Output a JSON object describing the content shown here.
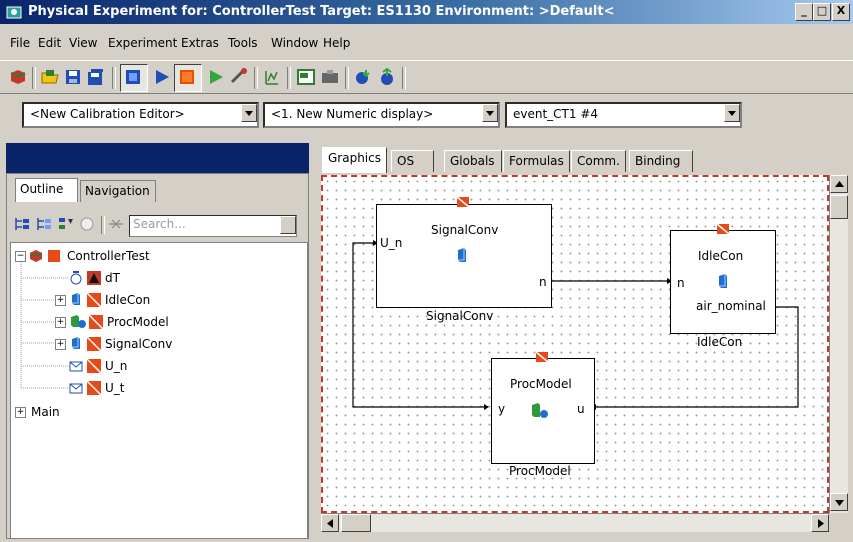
{
  "window": {
    "title": "Physical Experiment for: ControllerTest  Target: ES1130  Environment: >Default<",
    "controls": {
      "minimize": "_",
      "maximize": "□",
      "close": "X"
    }
  },
  "menu": [
    "File",
    "Edit",
    "View",
    "Experiment",
    "Extras",
    "Tools",
    "Window",
    "Help"
  ],
  "dropdowns": {
    "calibration": "<New Calibration Editor>",
    "display": "<1. New Numeric display>",
    "event": "event_CT1   #4"
  },
  "left_panel": {
    "tabs": [
      "Outline",
      "Navigation"
    ],
    "active_tab": "Outline",
    "search_placeholder": "Search...",
    "tree": [
      {
        "label": "ControllerTest",
        "expander": "−"
      },
      {
        "label": "dT",
        "expander": ""
      },
      {
        "label": "IdleCon",
        "expander": "+"
      },
      {
        "label": "ProcModel",
        "expander": "+"
      },
      {
        "label": "SignalConv",
        "expander": "+"
      },
      {
        "label": "U_n",
        "expander": ""
      },
      {
        "label": "U_t",
        "expander": ""
      },
      {
        "label": "Main",
        "expander": "+"
      }
    ]
  },
  "editor": {
    "tabs": [
      "Graphics",
      "OS",
      "Globals",
      "Formulas",
      "Comm.",
      "Binding"
    ],
    "active_tab": "Graphics",
    "blocks": {
      "signalconv": {
        "title": "SignalConv",
        "caption": "SignalConv",
        "in_port": "U_n",
        "out_port": "n"
      },
      "idlecon": {
        "title": "IdleCon",
        "caption": "IdleCon",
        "in_port": "n",
        "out_port": "air_nominal"
      },
      "procmodel": {
        "title": "ProcModel",
        "caption": "ProcModel",
        "in_port": "u",
        "out_port": "y"
      }
    }
  },
  "colors": {
    "title_start": "#0a246a",
    "title_end": "#a6caf0",
    "canvas_border": "#c0392b",
    "panel_header": "#0a246a"
  }
}
